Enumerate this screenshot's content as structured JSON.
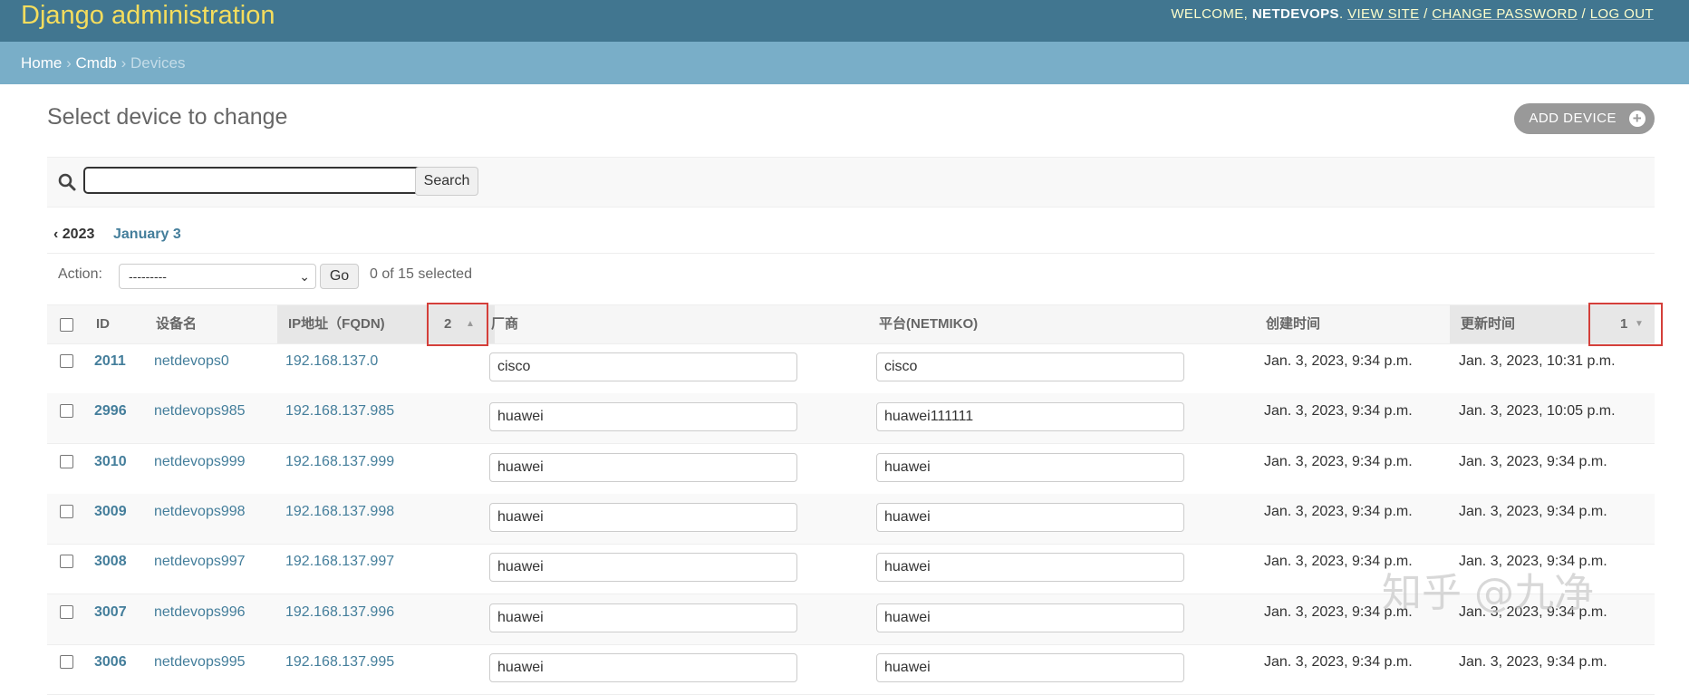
{
  "header": {
    "site_name": "Django administration",
    "welcome": "WELCOME,",
    "username": "NETDEVOPS",
    "view_site": "VIEW SITE",
    "change_password": "CHANGE PASSWORD",
    "log_out": "LOG OUT"
  },
  "breadcrumbs": {
    "home": "Home",
    "app": "Cmdb",
    "current": "Devices"
  },
  "page": {
    "title": "Select device to change",
    "add_button": "ADD DEVICE"
  },
  "search": {
    "value": "",
    "button": "Search"
  },
  "date_hierarchy": {
    "back": "‹ 2023",
    "current": "January 3"
  },
  "actions": {
    "label": "Action:",
    "selected": "---------",
    "go": "Go",
    "count": "0 of 15 selected"
  },
  "table": {
    "columns": {
      "id": "ID",
      "name": "设备名",
      "ip": "IP地址（FQDN)",
      "ip_sort_priority": "2",
      "vendor": "厂商",
      "platform": "平台(NETMIKO)",
      "created": "创建时间",
      "updated": "更新时间",
      "updated_sort_priority": "1"
    },
    "rows": [
      {
        "id": "2011",
        "name": "netdevops0",
        "ip": "192.168.137.0",
        "vendor": "cisco",
        "platform": "cisco",
        "created": "Jan. 3, 2023, 9:34 p.m.",
        "updated": "Jan. 3, 2023, 10:31 p.m."
      },
      {
        "id": "2996",
        "name": "netdevops985",
        "ip": "192.168.137.985",
        "vendor": "huawei",
        "platform": "huawei111111",
        "created": "Jan. 3, 2023, 9:34 p.m.",
        "updated": "Jan. 3, 2023, 10:05 p.m."
      },
      {
        "id": "3010",
        "name": "netdevops999",
        "ip": "192.168.137.999",
        "vendor": "huawei",
        "platform": "huawei",
        "created": "Jan. 3, 2023, 9:34 p.m.",
        "updated": "Jan. 3, 2023, 9:34 p.m."
      },
      {
        "id": "3009",
        "name": "netdevops998",
        "ip": "192.168.137.998",
        "vendor": "huawei",
        "platform": "huawei",
        "created": "Jan. 3, 2023, 9:34 p.m.",
        "updated": "Jan. 3, 2023, 9:34 p.m."
      },
      {
        "id": "3008",
        "name": "netdevops997",
        "ip": "192.168.137.997",
        "vendor": "huawei",
        "platform": "huawei",
        "created": "Jan. 3, 2023, 9:34 p.m.",
        "updated": "Jan. 3, 2023, 9:34 p.m."
      },
      {
        "id": "3007",
        "name": "netdevops996",
        "ip": "192.168.137.996",
        "vendor": "huawei",
        "platform": "huawei",
        "created": "Jan. 3, 2023, 9:34 p.m.",
        "updated": "Jan. 3, 2023, 9:34 p.m."
      },
      {
        "id": "3006",
        "name": "netdevops995",
        "ip": "192.168.137.995",
        "vendor": "huawei",
        "platform": "huawei",
        "created": "Jan. 3, 2023, 9:34 p.m.",
        "updated": "Jan. 3, 2023, 9:34 p.m."
      }
    ]
  },
  "watermark": "知乎 @九净",
  "colors": {
    "header_bg": "#417690",
    "breadcrumbs_bg": "#79aec8",
    "link": "#447e9b",
    "site_name": "#f5dd5d",
    "highlight_box": "#d43f3a"
  }
}
